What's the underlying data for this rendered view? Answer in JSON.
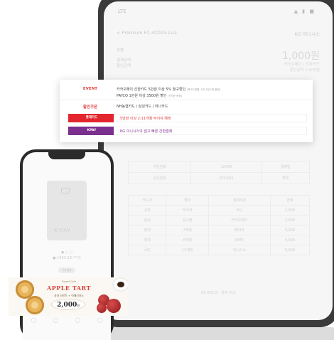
{
  "tablet": {
    "status_time": "LTE",
    "status_icons": "▲ ▮ ■",
    "header_title": "< Premium FC-4C01S-LLG",
    "header_right": "KG 이니시스",
    "row_label_1": "상품",
    "row_label_2": "결제금액",
    "row_label_3": "할인금액",
    "amount": "1,000원",
    "sub_1": "카카오페이 / 신한카드",
    "sub_2": "할인금액 1,000원",
    "table_row": [
      "주문번호",
      "12345",
      "결제일"
    ],
    "table_row_2": [
      "승인번호",
      "2023/01",
      "할부"
    ],
    "grid_rows": [
      [
        "카드사",
        "할부",
        "결제수단",
        "금액"
      ],
      [
        "신한",
        "무이자",
        "카드",
        "1,000"
      ],
      [
        "삼성",
        "일시불",
        "카카오페이",
        "2,000"
      ],
      [
        "현대",
        "3개월",
        "페이코",
        "3,000"
      ],
      [
        "롯데",
        "6개월",
        "KPAY",
        "4,000"
      ],
      [
        "국민",
        "12개월",
        "이니시스",
        "5,000"
      ]
    ],
    "footer": "KG INICIS · 결제 안내"
  },
  "popup": {
    "event_label": "EVENT",
    "event_line_1": "카카오페이 신한카드 5만원 이상 5% 청구할인",
    "event_line_1_note": "(최대 1만원, 1인 1일 1회 한정)",
    "event_line_2": "PAYCO 1만원 이상 3500원 할인",
    "event_line_2_note": "(선착순 한정)",
    "coupon_label": "할인쿠폰",
    "coupon_text": "NH농협카드 / 삼성카드 / 하나카드",
    "lotte_label": "롯데카드",
    "lotte_text": "5만원 이상 2-11개월 무이자 혜택",
    "kpay_label": "KPAY",
    "kpay_text": "KG 이니시스의 쉽고 빠른 간편결제",
    "colors": {
      "accent_red": "#e03c3c",
      "lotte": "#e3262e",
      "kpay": "#7b2f8e"
    }
  },
  "phone": {
    "card_brand": "K-PAY",
    "dots": "● ○ ○",
    "card_name": "● 1433-16-***C",
    "button": "카드변경",
    "tabs": [
      "◯",
      "◯",
      "◯",
      "◯"
    ]
  },
  "banner": {
    "small": "Sweet Cafe",
    "title": "APPLE TART",
    "subtitle": "사과 타르트 + 아메리카노",
    "price": "2,000",
    "price_unit": "원"
  }
}
